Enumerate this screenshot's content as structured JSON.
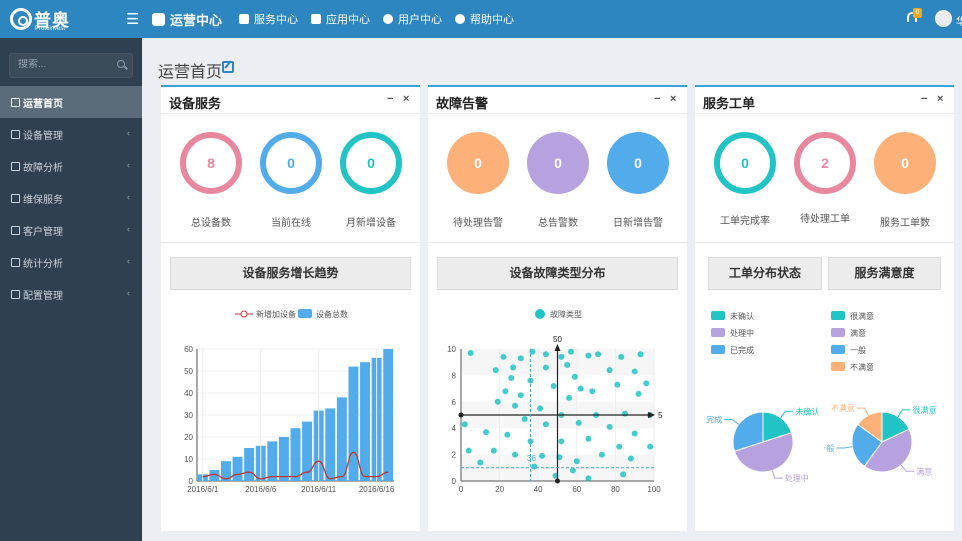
{
  "brand": {
    "name": "普奥",
    "tagline": "Proteinvest"
  },
  "topnav": {
    "title": "运营中心",
    "service": "服务中心",
    "apps": "应用中心",
    "users": "用户中心",
    "help": "帮助中心"
  },
  "notifications": {
    "count": "0"
  },
  "user": {
    "name_partial": "华"
  },
  "search": {
    "placeholder": "搜索..."
  },
  "sidebar": {
    "items": [
      {
        "label": "运营首页",
        "active": true
      },
      {
        "label": "设备管理"
      },
      {
        "label": "故障分析"
      },
      {
        "label": "维保服务"
      },
      {
        "label": "客户管理"
      },
      {
        "label": "统计分析"
      },
      {
        "label": "配置管理"
      }
    ]
  },
  "page_title": "运营首页",
  "colors": {
    "accent": "#2e86c0",
    "pink": "#e9879e",
    "blue": "#52acec",
    "teal": "#22c3c4",
    "orange": "#fdb178",
    "purple": "#b6a2de",
    "sidebar": "#2f4050"
  },
  "panels": {
    "device": {
      "title": "设备服务",
      "stats": [
        {
          "value": "8",
          "label": "总设备数"
        },
        {
          "value": "0",
          "label": "当前在线"
        },
        {
          "value": "0",
          "label": "月新增设备"
        }
      ],
      "chart_title": "设备服务增长趋势"
    },
    "fault": {
      "title": "故障告警",
      "stats": [
        {
          "value": "0",
          "label": "待处理告警"
        },
        {
          "value": "0",
          "label": "总告警数"
        },
        {
          "value": "0",
          "label": "日新增告警"
        }
      ],
      "chart_title": "设备故障类型分布"
    },
    "ticket": {
      "title": "服务工单",
      "stats": [
        {
          "value": "0",
          "label": "工单完成率"
        },
        {
          "value": "2",
          "label": "待处理工单"
        },
        {
          "value": "0",
          "label": "服务工单数"
        }
      ],
      "chart_title_1": "工单分布状态",
      "chart_title_2": "服务满意度"
    },
    "min_icon": "−",
    "close_icon": "×"
  },
  "chart_data": [
    {
      "type": "bar",
      "legend": [
        "新增加设备",
        "设备总数"
      ],
      "categories": [
        "2016/6/1",
        "2016/6/2",
        "2016/6/3",
        "2016/6/4",
        "2016/6/5",
        "2016/6/6",
        "2016/6/7",
        "2016/6/8",
        "2016/6/9",
        "2016/6/10",
        "2016/6/11",
        "2016/6/12",
        "2016/6/13",
        "2016/6/14",
        "2016/6/15",
        "2016/6/16",
        "2016/6/17"
      ],
      "tick_labels": [
        "2016/6/1",
        "2016/6/6",
        "2016/6/11",
        "2016/6/16"
      ],
      "series": [
        {
          "name": "设备总数",
          "type": "bar",
          "values": [
            3,
            5,
            9,
            11,
            15,
            16,
            18,
            20,
            24,
            27,
            32,
            33,
            38,
            52,
            54,
            56,
            60
          ]
        },
        {
          "name": "新增加设备",
          "type": "line",
          "values": [
            2,
            3,
            1,
            3,
            4,
            1,
            2,
            2,
            2,
            4,
            9,
            1,
            2,
            13,
            2,
            2,
            4
          ]
        }
      ],
      "ylim": [
        0,
        60
      ],
      "yticks": [
        0,
        10,
        20,
        30,
        40,
        50,
        60
      ],
      "grid": true,
      "legend_position": "top-center"
    },
    {
      "type": "scatter",
      "legend": [
        "故障类型"
      ],
      "series": [
        {
          "name": "故障类型",
          "points": [
            [
              5,
              9.7
            ],
            [
              22,
              9.4
            ],
            [
              31,
              9.3
            ],
            [
              37,
              9.8
            ],
            [
              44,
              9.6
            ],
            [
              52,
              9.4
            ],
            [
              57,
              9.8
            ],
            [
              66,
              9.5
            ],
            [
              71,
              9.6
            ],
            [
              83,
              9.4
            ],
            [
              93,
              9.6
            ],
            [
              18,
              8.4
            ],
            [
              27,
              8.6
            ],
            [
              44,
              8.6
            ],
            [
              55,
              8.8
            ],
            [
              59,
              7.9
            ],
            [
              77,
              8.4
            ],
            [
              90,
              8.3
            ],
            [
              96,
              7.4
            ],
            [
              26,
              7.8
            ],
            [
              36,
              7.6
            ],
            [
              48,
              7.2
            ],
            [
              62,
              7.0
            ],
            [
              81,
              7.3
            ],
            [
              23,
              6.8
            ],
            [
              31,
              6.5
            ],
            [
              56,
              6.3
            ],
            [
              68,
              6.8
            ],
            [
              92,
              6.6
            ],
            [
              19,
              6.0
            ],
            [
              28,
              5.7
            ],
            [
              41,
              5.5
            ],
            [
              52,
              5.0
            ],
            [
              70,
              5.0
            ],
            [
              85,
              5.1
            ],
            [
              98,
              5.0
            ],
            [
              33,
              4.7
            ],
            [
              44,
              4.3
            ],
            [
              61,
              4.4
            ],
            [
              77,
              4.1
            ],
            [
              90,
              3.6
            ],
            [
              2,
              4.3
            ],
            [
              13,
              3.7
            ],
            [
              24,
              3.5
            ],
            [
              36,
              3.0
            ],
            [
              52,
              3.0
            ],
            [
              66,
              3.2
            ],
            [
              82,
              2.6
            ],
            [
              4,
              2.3
            ],
            [
              17,
              2.3
            ],
            [
              28,
              2.0
            ],
            [
              42,
              1.9
            ],
            [
              51,
              1.8
            ],
            [
              60,
              1.5
            ],
            [
              73,
              2.0
            ],
            [
              88,
              1.7
            ],
            [
              98,
              2.6
            ],
            [
              10,
              1.4
            ],
            [
              38,
              1.1
            ],
            [
              58,
              0.8
            ],
            [
              66,
              0.2
            ],
            [
              84,
              0.5
            ],
            [
              49,
              0.4
            ]
          ]
        }
      ],
      "markers": [
        {
          "axis": "x",
          "value": 50,
          "label": "50"
        },
        {
          "axis": "y",
          "value": 5,
          "label": "5"
        },
        {
          "axis": "x",
          "value": 36,
          "label": "36"
        },
        {
          "axis": "y",
          "value": 1,
          "label": ""
        }
      ],
      "xlim": [
        0,
        100
      ],
      "ylim": [
        0,
        10
      ],
      "xticks": [
        0,
        20,
        40,
        60,
        80,
        100
      ],
      "yticks": [
        0,
        2,
        4,
        6,
        8,
        10
      ],
      "legend_position": "top-center"
    },
    {
      "type": "pie",
      "legend": [
        "未确认",
        "处理中",
        "已完成"
      ],
      "slices": [
        {
          "label": "未确认",
          "value": 20,
          "color": "#22c3c4"
        },
        {
          "label": "处理中",
          "value": 50,
          "color": "#b6a2de"
        },
        {
          "label": "完成",
          "value": 30,
          "color": "#52acec"
        }
      ],
      "legend_position": "top-left"
    },
    {
      "type": "pie",
      "legend": [
        "很满意",
        "满意",
        "一般",
        "不满意"
      ],
      "slices": [
        {
          "label": "很满意",
          "value": 18,
          "color": "#22c3c4"
        },
        {
          "label": "满意",
          "value": 42,
          "color": "#b6a2de"
        },
        {
          "label": "一般",
          "value": 25,
          "color": "#52acec"
        },
        {
          "label": "不满意",
          "value": 15,
          "color": "#fdb178"
        }
      ],
      "legend_position": "top-left"
    }
  ]
}
